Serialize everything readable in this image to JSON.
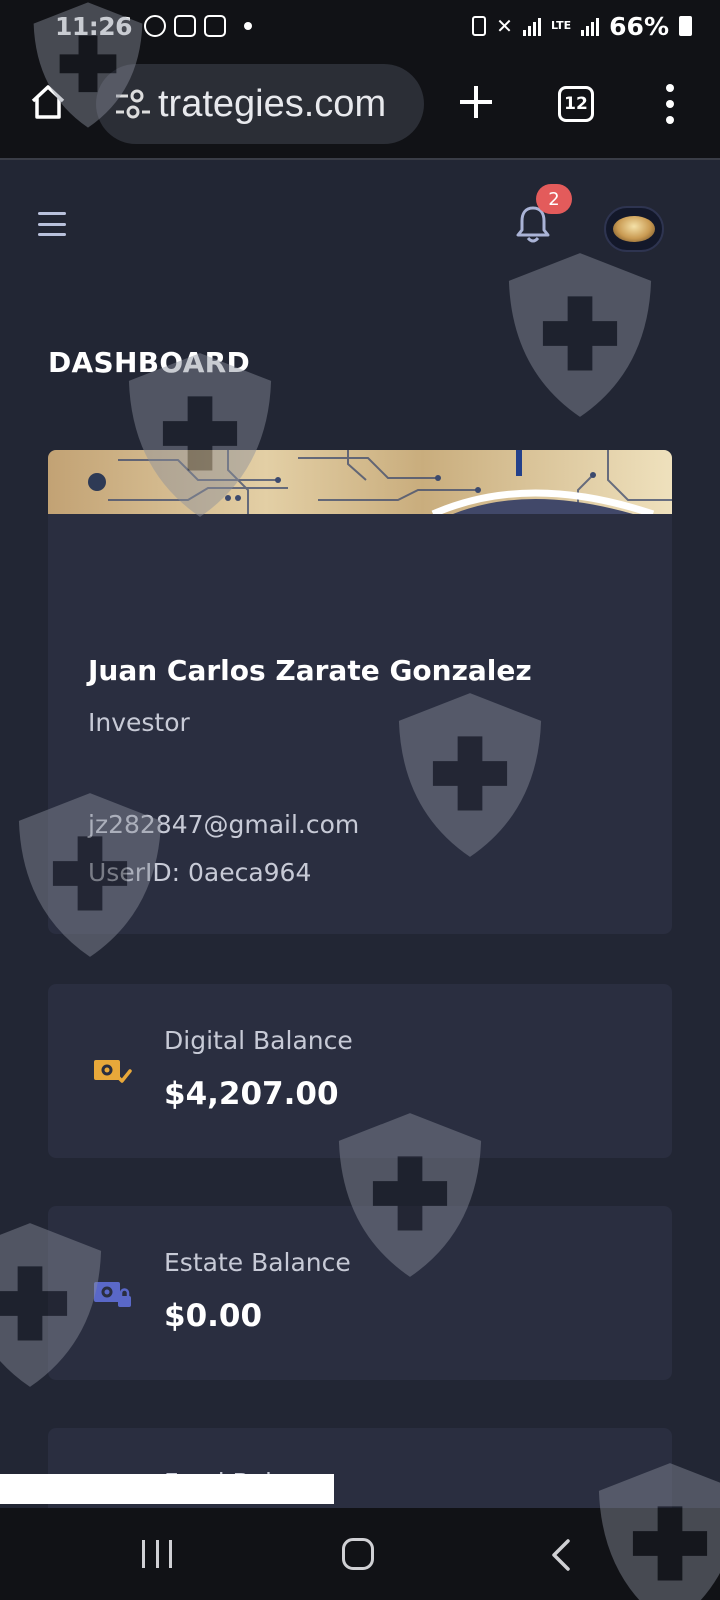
{
  "status_bar": {
    "time": "11:26",
    "lte": "LTE",
    "battery": "66%"
  },
  "browser": {
    "url": "trategies.com",
    "tab_count": "12"
  },
  "header": {
    "notification_count": "2"
  },
  "page": {
    "title": "DASHBOARD"
  },
  "profile": {
    "name": "Juan Carlos Zarate Gonzalez",
    "role": "Investor",
    "email": "jz282847@gmail.com",
    "user_id": "UserID: 0aeca964"
  },
  "balances": [
    {
      "label": "Digital Balance",
      "value": "$4,207.00",
      "icon": "money-check-icon",
      "icon_color": "#e8a83a"
    },
    {
      "label": "Estate Balance",
      "value": "$0.00",
      "icon": "money-lock-icon",
      "icon_color": "#5a68c8"
    },
    {
      "label": "Fund Balance"
    }
  ],
  "colors": {
    "background": "#222634",
    "card": "#2a2e40",
    "badge": "#e35b5b"
  }
}
